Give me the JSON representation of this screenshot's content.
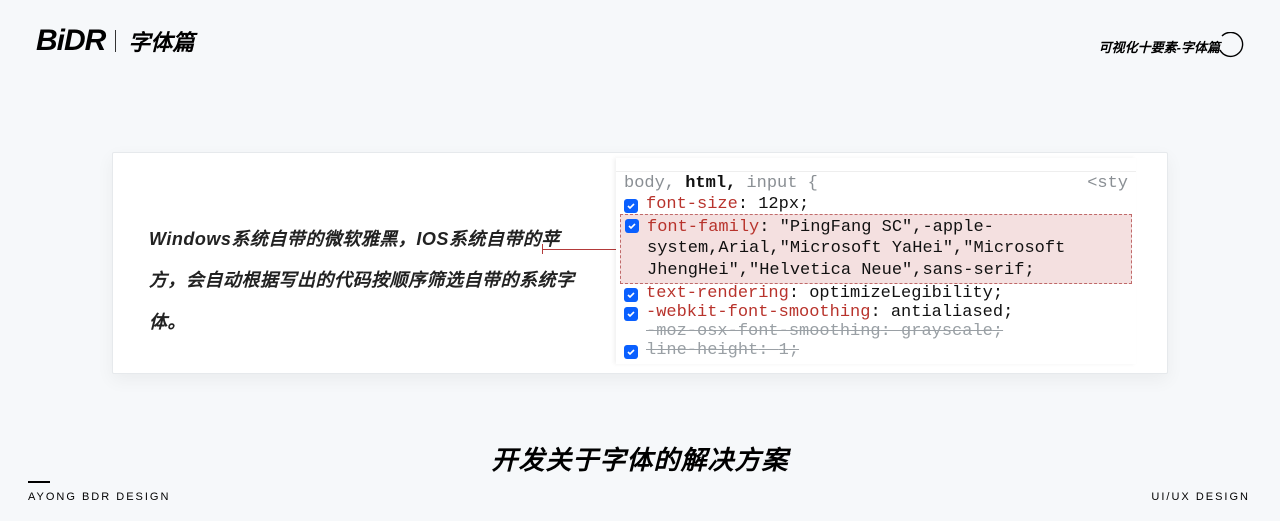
{
  "header": {
    "logo": "BiDR",
    "subtitle": "字体篇"
  },
  "top_right": "可视化十要素-字体篇",
  "description": "Windows系统自带的微软雅黑，IOS系统自带的苹方，会自动根据写出的代码按顺序筛选自带的系统字体。",
  "code": {
    "selector_dim1": "body,",
    "selector_strong": " html,",
    "selector_dim2": " input ",
    "brace_open": "{",
    "sty_tag": "<sty",
    "rules": {
      "font_size": {
        "prop": "font-size",
        "value": "12px"
      },
      "font_family": {
        "prop": "font-family",
        "value": "\"PingFang SC\",-apple-system,Arial,\"Microsoft YaHei\",\"Microsoft JhengHei\",\"Helvetica Neue\",sans-serif"
      },
      "text_rendering": {
        "prop": "text-rendering",
        "value": "optimizeLegibility"
      },
      "webkit_smoothing": {
        "prop": "-webkit-font-smoothing",
        "value": "antialiased"
      },
      "moz_smoothing": {
        "prop": "-moz-osx-font-smoothing",
        "value": "grayscale"
      },
      "line_height": {
        "prop": "line-height",
        "value": "1"
      }
    }
  },
  "bottom_title": "开发关于字体的解决方案",
  "footer": {
    "left": "AYONG BDR DESIGN",
    "right": "UI/UX DESIGN"
  }
}
